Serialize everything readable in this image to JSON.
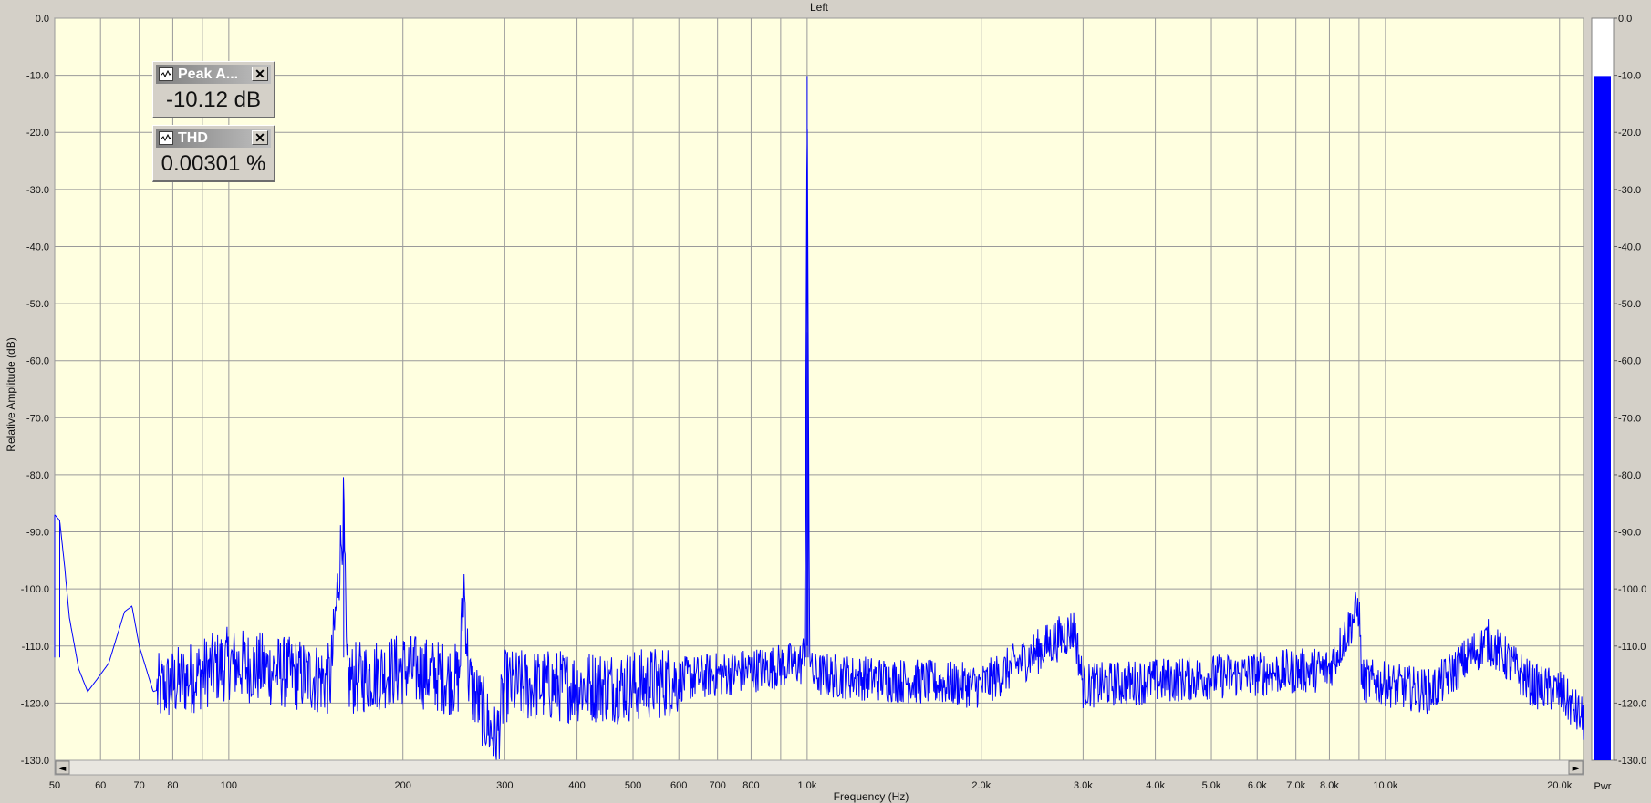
{
  "chart_data": {
    "type": "line",
    "title": "Left",
    "xlabel": "Frequency (Hz)",
    "ylabel": "Relative Amplitude (dB)",
    "x_scale": "log",
    "xlim": [
      50,
      22000
    ],
    "ylim": [
      -130,
      0
    ],
    "grid": true,
    "x_ticks": [
      {
        "value": 50,
        "label": "50"
      },
      {
        "value": 60,
        "label": "60"
      },
      {
        "value": 70,
        "label": "70"
      },
      {
        "value": 80,
        "label": "80"
      },
      {
        "value": 100,
        "label": "100"
      },
      {
        "value": 200,
        "label": "200"
      },
      {
        "value": 300,
        "label": "300"
      },
      {
        "value": 400,
        "label": "400"
      },
      {
        "value": 500,
        "label": "500"
      },
      {
        "value": 600,
        "label": "600"
      },
      {
        "value": 700,
        "label": "700"
      },
      {
        "value": 800,
        "label": "800"
      },
      {
        "value": 1000,
        "label": "1.0k"
      },
      {
        "value": 2000,
        "label": "2.0k"
      },
      {
        "value": 3000,
        "label": "3.0k"
      },
      {
        "value": 4000,
        "label": "4.0k"
      },
      {
        "value": 5000,
        "label": "5.0k"
      },
      {
        "value": 6000,
        "label": "6.0k"
      },
      {
        "value": 7000,
        "label": "7.0k"
      },
      {
        "value": 8000,
        "label": "8.0k"
      },
      {
        "value": 10000,
        "label": "10.0k"
      },
      {
        "value": 20000,
        "label": "20.0k"
      }
    ],
    "x_minor_grid": [
      90,
      900,
      9000
    ],
    "y_ticks": [
      {
        "value": 0,
        "label": "0.0"
      },
      {
        "value": -10,
        "label": "-10.0"
      },
      {
        "value": -20,
        "label": "-20.0"
      },
      {
        "value": -30,
        "label": "-30.0"
      },
      {
        "value": -40,
        "label": "-40.0"
      },
      {
        "value": -50,
        "label": "-50.0"
      },
      {
        "value": -60,
        "label": "-60.0"
      },
      {
        "value": -70,
        "label": "-70.0"
      },
      {
        "value": -80,
        "label": "-80.0"
      },
      {
        "value": -90,
        "label": "-90.0"
      },
      {
        "value": -100,
        "label": "-100.0"
      },
      {
        "value": -110,
        "label": "-110.0"
      },
      {
        "value": -120,
        "label": "-120.0"
      },
      {
        "value": -130,
        "label": "-130.0"
      }
    ],
    "series": [
      {
        "color": "#0000ff",
        "noise_floor_db": -116,
        "noise_floor_end_db": -118,
        "rolloff_end_db": -123,
        "points": [
          [
            50,
            -87
          ],
          [
            51,
            -88
          ],
          [
            52,
            -96
          ],
          [
            53,
            -105
          ],
          [
            55,
            -114
          ],
          [
            57,
            -118
          ],
          [
            59,
            -116
          ],
          [
            62,
            -113
          ],
          [
            66,
            -104
          ],
          [
            68,
            -103
          ],
          [
            70,
            -110
          ],
          [
            74,
            -118
          ],
          [
            100,
            -113
          ],
          [
            150,
            -116
          ],
          [
            158,
            -86
          ],
          [
            160,
            -116
          ],
          [
            200,
            -114
          ],
          [
            250,
            -116
          ],
          [
            255,
            -99
          ],
          [
            260,
            -116
          ],
          [
            290,
            -127
          ],
          [
            300,
            -117
          ],
          [
            500,
            -117
          ],
          [
            980,
            -113
          ],
          [
            990,
            -110
          ],
          [
            996,
            -55
          ],
          [
            1000,
            -10.12
          ],
          [
            1004,
            -55
          ],
          [
            1010,
            -110
          ],
          [
            1020,
            -115
          ],
          [
            2000,
            -117
          ],
          [
            2900,
            -107
          ],
          [
            3000,
            -117
          ],
          [
            8000,
            -114
          ],
          [
            9000,
            -103
          ],
          [
            9100,
            -116
          ],
          [
            12000,
            -118
          ],
          [
            15000,
            -109
          ],
          [
            18000,
            -117
          ],
          [
            20000,
            -118
          ],
          [
            22000,
            -123
          ]
        ]
      }
    ]
  },
  "power_bar": {
    "label": "Pwr",
    "value_db": -10.12,
    "color": "#0000ff",
    "ticks": [
      "0.0",
      "-10.0",
      "-20.0",
      "-30.0",
      "-40.0",
      "-50.0",
      "-60.0",
      "-70.0",
      "-80.0",
      "-90.0",
      "-100.0",
      "-110.0",
      "-120.0",
      "-130.0"
    ]
  },
  "meters": [
    {
      "name": "Peak A...",
      "value": "-10.12 dB"
    },
    {
      "name": "THD",
      "value": "0.00301 %"
    }
  ],
  "scrollbar": {
    "left_arrow": "◄",
    "right_arrow": "►"
  },
  "colors": {
    "plot_bg": "#ffffe0",
    "grid": "#9a9a9a",
    "frame": "#d4d0c8",
    "trace": "#0000ff"
  }
}
